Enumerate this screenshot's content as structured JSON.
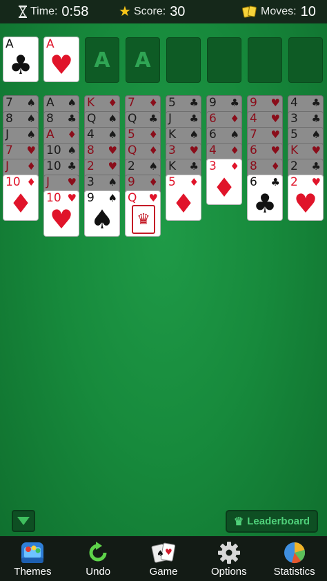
{
  "status": {
    "time_label": "Time:",
    "time_value": "0:58",
    "score_label": "Score:",
    "score_value": "30",
    "moves_label": "Moves:",
    "moves_value": "10"
  },
  "foundations": [
    {
      "rank": "A",
      "suit": "♣",
      "color": "black"
    },
    {
      "rank": "A",
      "suit": "♥",
      "color": "red"
    },
    {
      "ghost": "A"
    },
    {
      "ghost": "A"
    }
  ],
  "free_cells": [
    {},
    {},
    {},
    {}
  ],
  "tableau": [
    [
      {
        "r": "7",
        "s": "♠",
        "c": "black"
      },
      {
        "r": "8",
        "s": "♠",
        "c": "black"
      },
      {
        "r": "J",
        "s": "♠",
        "c": "black"
      },
      {
        "r": "7",
        "s": "♥",
        "c": "red"
      },
      {
        "r": "J",
        "s": "♦",
        "c": "red"
      },
      {
        "r": "10",
        "s": "♦",
        "c": "red"
      }
    ],
    [
      {
        "r": "A",
        "s": "♠",
        "c": "black"
      },
      {
        "r": "8",
        "s": "♣",
        "c": "black"
      },
      {
        "r": "A",
        "s": "♦",
        "c": "red"
      },
      {
        "r": "10",
        "s": "♠",
        "c": "black"
      },
      {
        "r": "10",
        "s": "♣",
        "c": "black"
      },
      {
        "r": "J",
        "s": "♥",
        "c": "red"
      },
      {
        "r": "10",
        "s": "♥",
        "c": "red"
      }
    ],
    [
      {
        "r": "K",
        "s": "♦",
        "c": "red"
      },
      {
        "r": "Q",
        "s": "♠",
        "c": "black"
      },
      {
        "r": "4",
        "s": "♠",
        "c": "black"
      },
      {
        "r": "8",
        "s": "♥",
        "c": "red"
      },
      {
        "r": "2",
        "s": "♥",
        "c": "red"
      },
      {
        "r": "3",
        "s": "♠",
        "c": "black"
      },
      {
        "r": "9",
        "s": "♠",
        "c": "black"
      }
    ],
    [
      {
        "r": "7",
        "s": "♦",
        "c": "red"
      },
      {
        "r": "Q",
        "s": "♣",
        "c": "black"
      },
      {
        "r": "5",
        "s": "♦",
        "c": "red"
      },
      {
        "r": "Q",
        "s": "♦",
        "c": "red"
      },
      {
        "r": "2",
        "s": "♠",
        "c": "black"
      },
      {
        "r": "9",
        "s": "♦",
        "c": "red"
      },
      {
        "r": "Q",
        "s": "♥",
        "c": "red",
        "face": true
      }
    ],
    [
      {
        "r": "5",
        "s": "♣",
        "c": "black"
      },
      {
        "r": "J",
        "s": "♣",
        "c": "black"
      },
      {
        "r": "K",
        "s": "♠",
        "c": "black"
      },
      {
        "r": "3",
        "s": "♥",
        "c": "red"
      },
      {
        "r": "K",
        "s": "♣",
        "c": "black"
      },
      {
        "r": "5",
        "s": "♦",
        "c": "red"
      }
    ],
    [
      {
        "r": "9",
        "s": "♣",
        "c": "black"
      },
      {
        "r": "6",
        "s": "♦",
        "c": "red"
      },
      {
        "r": "6",
        "s": "♠",
        "c": "black"
      },
      {
        "r": "4",
        "s": "♦",
        "c": "red"
      },
      {
        "r": "3",
        "s": "♦",
        "c": "red"
      }
    ],
    [
      {
        "r": "9",
        "s": "♥",
        "c": "red"
      },
      {
        "r": "4",
        "s": "♥",
        "c": "red"
      },
      {
        "r": "7",
        "s": "♥",
        "c": "red"
      },
      {
        "r": "6",
        "s": "♥",
        "c": "red"
      },
      {
        "r": "8",
        "s": "♦",
        "c": "red"
      },
      {
        "r": "6",
        "s": "♣",
        "c": "black"
      }
    ],
    [
      {
        "r": "4",
        "s": "♣",
        "c": "black"
      },
      {
        "r": "3",
        "s": "♣",
        "c": "black"
      },
      {
        "r": "5",
        "s": "♠",
        "c": "black"
      },
      {
        "r": "K",
        "s": "♥",
        "c": "red"
      },
      {
        "r": "2",
        "s": "♣",
        "c": "black"
      },
      {
        "r": "2",
        "s": "♥",
        "c": "red"
      }
    ]
  ],
  "controls": {
    "leaderboard_label": "Leaderboard"
  },
  "bottom_nav": [
    {
      "label": "Themes",
      "icon": "themes-icon"
    },
    {
      "label": "Undo",
      "icon": "undo-icon"
    },
    {
      "label": "Game",
      "icon": "game-icon"
    },
    {
      "label": "Options",
      "icon": "gear-icon"
    },
    {
      "label": "Statistics",
      "icon": "statistics-icon"
    }
  ],
  "colors": {
    "felt": "#178a3c",
    "card_red": "#e0142a",
    "accent_green": "#4fd07a"
  }
}
